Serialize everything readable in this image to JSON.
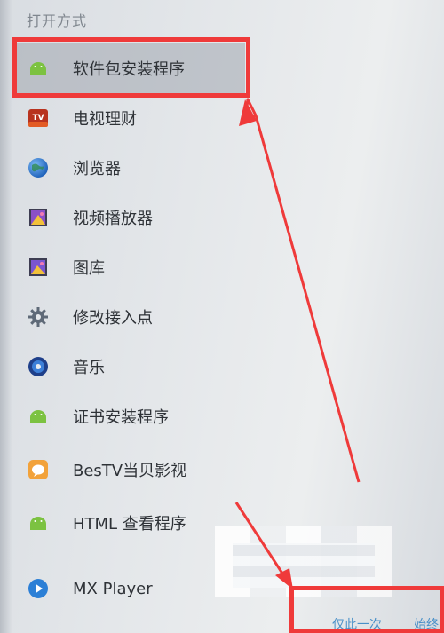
{
  "dialog": {
    "title": "打开方式"
  },
  "apps": [
    {
      "label": "软件包安装程序",
      "icon": "android-icon",
      "selected": true
    },
    {
      "label": "电视理财",
      "icon": "tv-finance-icon",
      "selected": false
    },
    {
      "label": "浏览器",
      "icon": "globe-icon",
      "selected": false
    },
    {
      "label": "视频播放器",
      "icon": "video-player-icon",
      "selected": false
    },
    {
      "label": "图库",
      "icon": "gallery-icon",
      "selected": false
    },
    {
      "label": "修改接入点",
      "icon": "gear-icon",
      "selected": false
    },
    {
      "label": "音乐",
      "icon": "music-icon",
      "selected": false
    },
    {
      "label": "证书安装程序",
      "icon": "android-icon",
      "selected": false
    },
    {
      "label": "BesTV当贝影视",
      "icon": "bestv-icon",
      "selected": false
    },
    {
      "label": "HTML 查看程序",
      "icon": "android-icon",
      "selected": false
    },
    {
      "label": "MX Player",
      "icon": "play-icon",
      "selected": false
    }
  ],
  "actions": {
    "just_once": "仅此一次",
    "always": "始终"
  },
  "colors": {
    "annotation_red": "#ef3a3a",
    "android_green": "#7cc241",
    "action_blue": "#4a90c8"
  }
}
